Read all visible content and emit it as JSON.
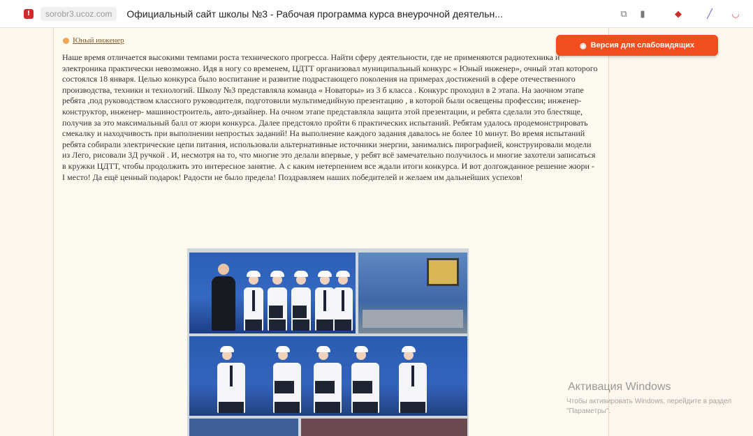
{
  "browser": {
    "url": "sorobr3.ucoz.com",
    "tab_title": "Официальный сайт школы №3 - Рабочая программа курса внеурочной деятельн..."
  },
  "page": {
    "breadcrumb": "Юный инженер",
    "accessibility_button": "Версия для слабовидящих",
    "article_text": "Наше время отличается высокими темпами роста технического прогресса. Найти сферу деятельности, где не применяются радиотехника и электроника практически невозможно. Идя в ногу со временем, ЦДТТ организовал муниципальный конкурс « Юный инженер», очный этап которого состоялся 18 января. Целью конкурса было воспитание и развитие подрастающего поколения на примерах достижений в сфере отечественного производства, техники и технологий. Школу №3 представляла команда « Новаторы» из 3 б класса . Конкурс проходил в 2 этапа. На заочном этапе ребята ,под руководством классного руководителя, подготовили мультимедийную презентацию , в которой были освещены профессии; инженер- конструктор, инженер- машиностроитель, авто-дизайнер. На очном этапе представляла защита этой презентации, и ребята сделали это блестяще, получив за это максимальный балл от жюри конкурса. Далее предстояло пройти 6 практических испытаний. Ребятам удалось продемонстрировать смекалку и находчивость при выполнении непростых заданий! На выполнение каждого задания давалось не более 10 минут. Во время испытаний ребята собирали электрические цепи питания, использовали альтернативные источники энергии, занимались пирографией, конструировали модели из Лего, рисовали 3Д ручкой . И, несмотря на то, что многие это делали впервые, у ребят всё замечательно получилось и многие захотели записаться в кружки ЦДТТ, чтобы продолжить это интересное занятие. А с каким нетерпением все ждали итоги конкурса. И вот долгожданное решение жюри - I место! Да ещё ценный подарок! Радости не было предела! Поздравляем наших победителей и желаем им дальнейших успехов!"
  },
  "windows_watermark": {
    "title": "Активация Windows",
    "subtitle": "Чтобы активировать Windows, перейдите в раздел \"Параметры\"."
  },
  "colors": {
    "accent": "#f24e1e",
    "page_background": "#fffaf0",
    "text": "#333333"
  },
  "icons": [
    "warning-icon",
    "translate-icon",
    "bookmark-icon",
    "extension-icon",
    "pen-icon",
    "pocket-icon",
    "eye-icon"
  ]
}
